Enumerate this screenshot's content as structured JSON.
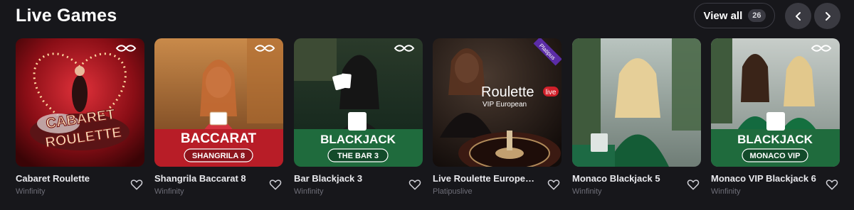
{
  "section": {
    "title": "Live Games",
    "view_all_label": "View all",
    "view_all_count": "26"
  },
  "games": [
    {
      "title": "Cabaret Roulette",
      "provider": "Winfinity",
      "art_line1": "CABARET",
      "art_line2": "ROULETTE"
    },
    {
      "title": "Shangrila Baccarat 8",
      "provider": "Winfinity",
      "art_line1": "BACCARAT",
      "art_line2": "SHANGRILA 8"
    },
    {
      "title": "Bar Blackjack 3",
      "provider": "Winfinity",
      "art_line1": "BLACKJACK",
      "art_line2": "THE BAR 3"
    },
    {
      "title": "Live Roulette European ...",
      "provider": "Platipuslive",
      "art_line1": "Roulette",
      "art_line2": "VIP European",
      "art_badge": "live",
      "art_corner": "Platipus"
    },
    {
      "title": "Monaco Blackjack 5",
      "provider": "Winfinity"
    },
    {
      "title": "Monaco VIP Blackjack 6",
      "provider": "Winfinity",
      "art_line1": "BLACKJACK",
      "art_line2": "MONACO VIP"
    }
  ],
  "colors": {
    "background": "#17171b",
    "accent_red": "#c7202a",
    "accent_green": "#1f6b3d"
  },
  "icons": {
    "prev": "chevron-left-icon",
    "next": "chevron-right-icon",
    "favorite": "heart-outline-icon",
    "provider_mark": "infinity-icon"
  }
}
